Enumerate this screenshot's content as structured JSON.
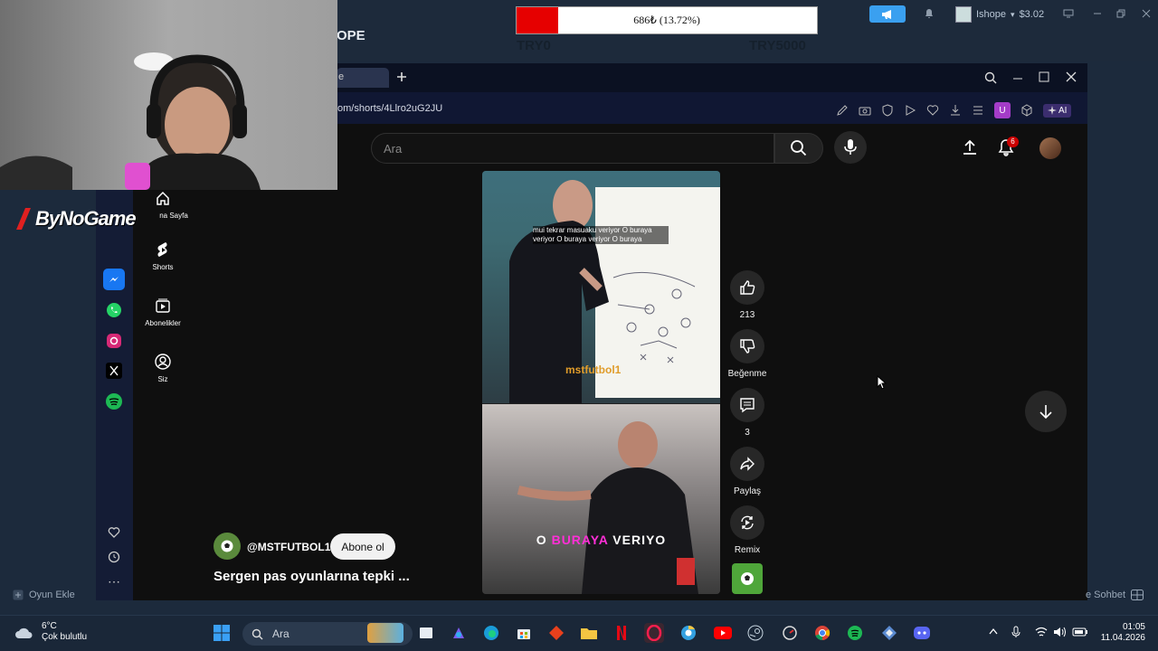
{
  "stream_overlay": {
    "brand_partial": "OPE",
    "goal_text": "686₺ (13.72%)",
    "goal_progress_percent": 13.72,
    "goal_min": "TRY0",
    "goal_max": "TRY5000",
    "user_name": "Ishope",
    "user_balance": "$3.02",
    "sponsor": "ByNoGame",
    "add_game": "Oyun Ekle",
    "chat_partial": "e Sohbet"
  },
  "browser": {
    "tab_title": "e",
    "url": "om/shorts/4Llro2uG2JU",
    "ai_label": "AI",
    "ext_badge": "U"
  },
  "youtube": {
    "search_placeholder": "Ara",
    "notification_count": "6",
    "guide": [
      {
        "label": "na Sayfa",
        "icon": "home-icon"
      },
      {
        "label": "Shorts",
        "icon": "shorts-icon"
      },
      {
        "label": "Abonelikler",
        "icon": "subscriptions-icon"
      },
      {
        "label": "Siz",
        "icon": "account-icon"
      }
    ],
    "video": {
      "subtitle_line": "mui tekrar masuaku veriyor O buraya veriyor O buraya veriyor O buraya",
      "watermark": "mstfutbol1",
      "overlay_pre": "O ",
      "overlay_highlight": "BURAYA",
      "overlay_post": " VERIYO"
    },
    "actions": {
      "like_count": "213",
      "dislike_label": "Beğenme",
      "comments_count": "3",
      "share_label": "Paylaş",
      "remix_label": "Remix"
    },
    "channel_name": "@MSTFUTBOL1",
    "subscribe_label": "Abone ol",
    "video_title": "Sergen pas oyunlarına tepki ..."
  },
  "taskbar": {
    "temperature": "6°C",
    "weather_text": "Çok bulutlu",
    "search_label": "Ara",
    "time": "01:05",
    "date": "11.04.2026"
  }
}
